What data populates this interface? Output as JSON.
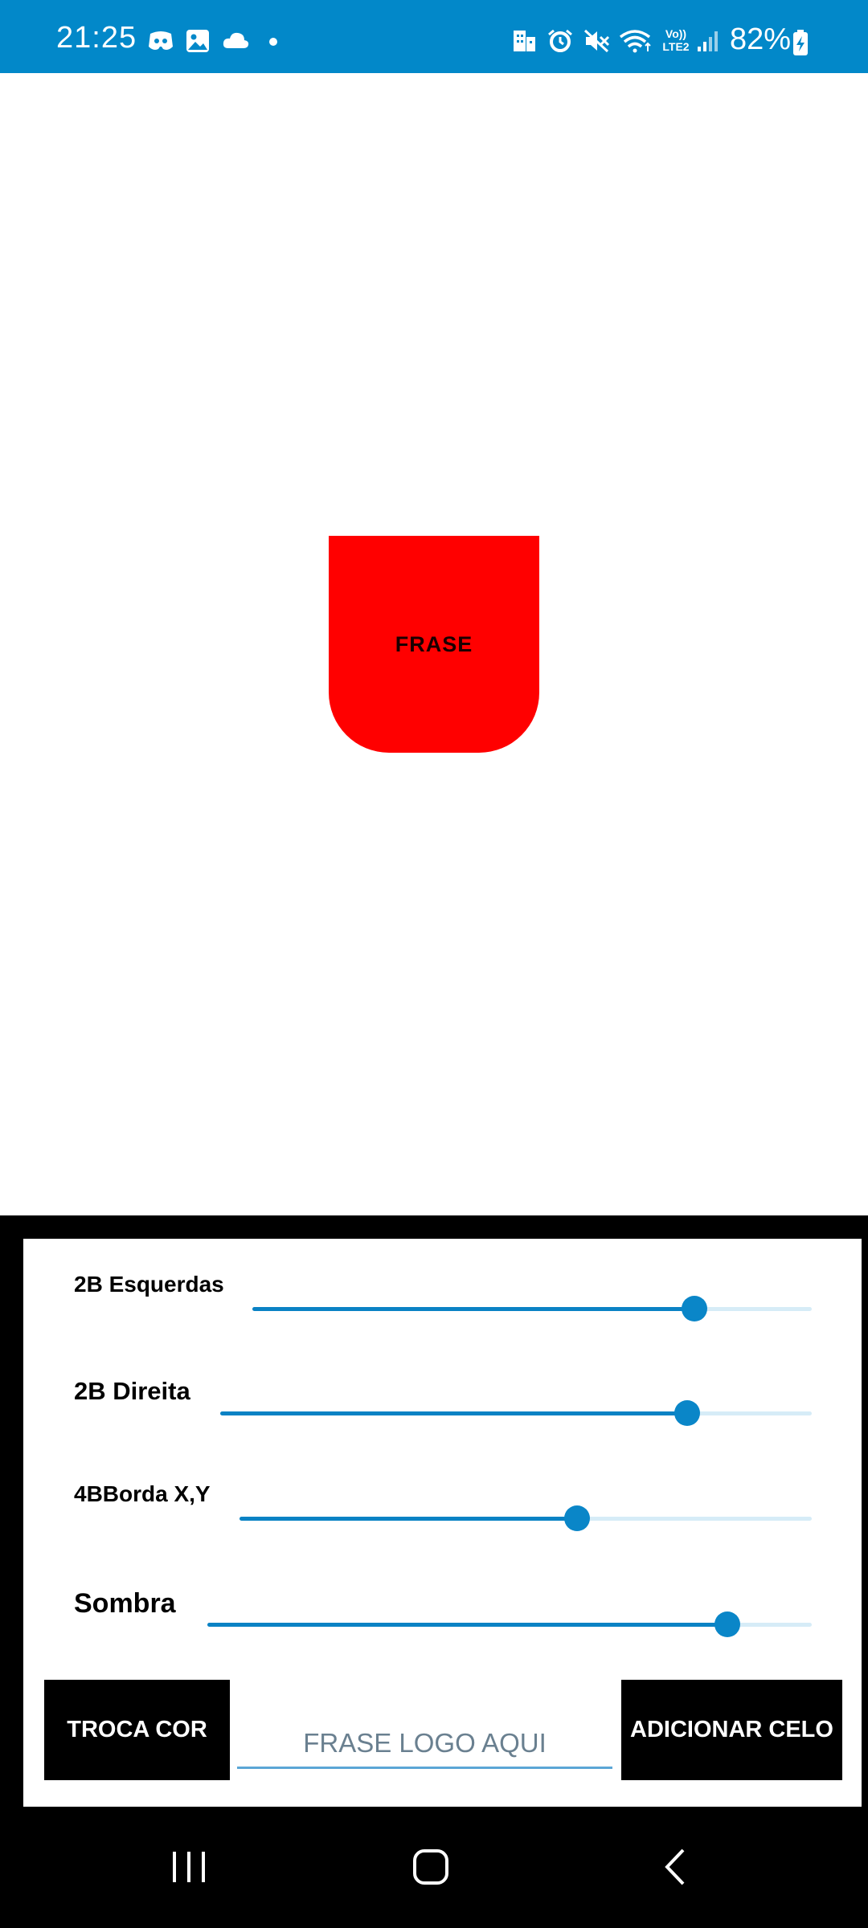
{
  "status_bar": {
    "time": "21:25",
    "battery": "82%",
    "left_icons": [
      "discord-icon",
      "image-icon",
      "cloud-icon",
      "dot-icon"
    ],
    "right_icons": [
      "sim-icon",
      "alarm-icon",
      "mute-icon",
      "wifi-icon",
      "volte-lte2-icon",
      "signal-icon",
      "battery-charging-icon"
    ],
    "volte_label": "Vo))",
    "lte_label": "LTE2",
    "color": "#0288c9"
  },
  "preview": {
    "text": "FRASE",
    "color": "#ff0000"
  },
  "sliders": [
    {
      "label": "2B Esquerdas",
      "value": 0.79
    },
    {
      "label": "2B Direita",
      "value": 0.79
    },
    {
      "label": "4BBorda X,Y",
      "value": 0.59
    },
    {
      "label": "Sombra",
      "value": 0.86
    }
  ],
  "actions": {
    "swap_color_label": "TROCA COR",
    "phrase_placeholder": "FRASE LOGO AQUI",
    "add_seal_label": "ADICIONAR CELO"
  },
  "accent_color": "#0a86c8",
  "nav": {
    "icons": [
      "recent-apps-icon",
      "home-icon",
      "back-icon"
    ]
  }
}
